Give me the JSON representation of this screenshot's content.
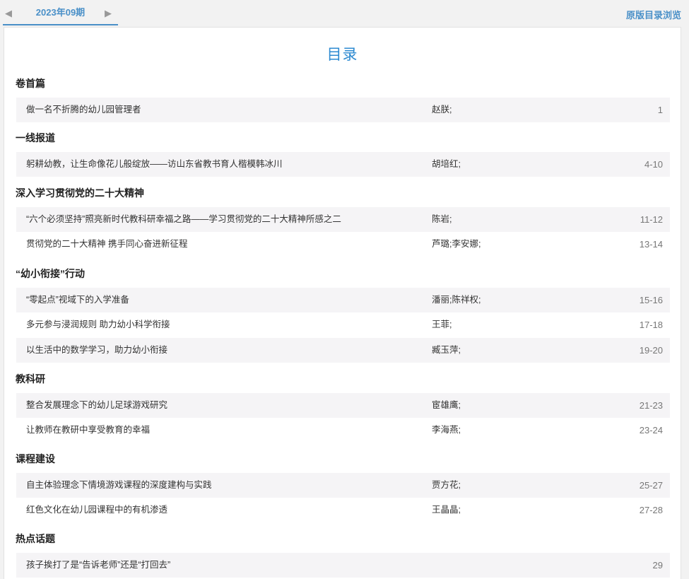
{
  "nav": {
    "prev_icon": "triangle-left-icon",
    "next_icon": "triangle-right-icon",
    "issue": "2023年09期",
    "original_link": "原版目录浏览"
  },
  "toc": {
    "title": "目录",
    "sections": [
      {
        "name": "卷首篇",
        "articles": [
          {
            "title": "做一名不折腾的幼儿园管理者",
            "author": "赵朕;",
            "pages": "1"
          }
        ]
      },
      {
        "name": "一线报道",
        "articles": [
          {
            "title": "躬耕幼教，让生命像花儿般绽放——访山东省教书育人楷模韩冰川",
            "author": "胡培红;",
            "pages": "4-10"
          }
        ]
      },
      {
        "name": "深入学习贯彻党的二十大精神",
        "articles": [
          {
            "title": "“六个必须坚持”照亮新时代教科研幸福之路——学习贯彻党的二十大精神所感之二",
            "author": "陈岩;",
            "pages": "11-12"
          },
          {
            "title": "贯彻党的二十大精神 携手同心奋进新征程",
            "author": "芦璐;李安娜;",
            "pages": "13-14"
          }
        ]
      },
      {
        "name": "“幼小衔接”行动",
        "articles": [
          {
            "title": "“零起点”视域下的入学准备",
            "author": "潘丽;陈祥权;",
            "pages": "15-16"
          },
          {
            "title": "多元参与浸润规则 助力幼小科学衔接",
            "author": "王菲;",
            "pages": "17-18"
          },
          {
            "title": "以生活中的数学学习，助力幼小衔接",
            "author": "臧玉萍;",
            "pages": "19-20"
          }
        ]
      },
      {
        "name": "教科研",
        "articles": [
          {
            "title": "整合发展理念下的幼儿足球游戏研究",
            "author": "宦雄鹰;",
            "pages": "21-23"
          },
          {
            "title": "让教师在教研中享受教育的幸福",
            "author": "李海燕;",
            "pages": "23-24"
          }
        ]
      },
      {
        "name": "课程建设",
        "articles": [
          {
            "title": "自主体验理念下情境游戏课程的深度建构与实践",
            "author": "贾方花;",
            "pages": "25-27"
          },
          {
            "title": "红色文化在幼儿园课程中的有机渗透",
            "author": "王晶晶;",
            "pages": "27-28"
          }
        ]
      },
      {
        "name": "热点话题",
        "articles": [
          {
            "title": "孩子挨打了是“告诉老师”还是“打回去”",
            "author": "",
            "pages": "29"
          }
        ]
      }
    ]
  }
}
